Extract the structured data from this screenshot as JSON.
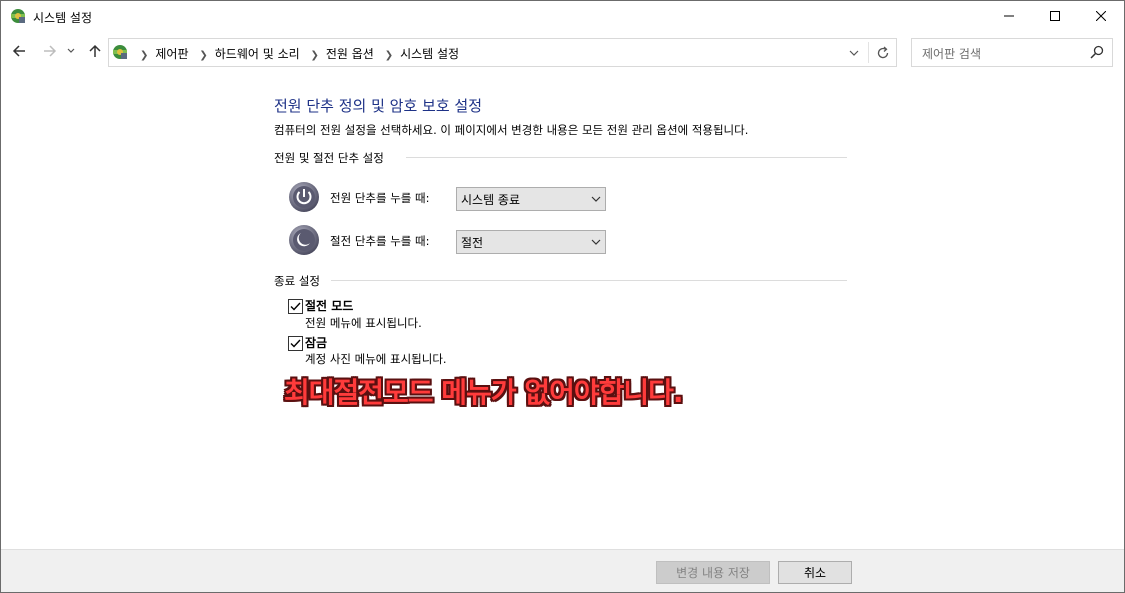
{
  "window": {
    "title": "시스템 설정",
    "icon": "control-panel-power-icon"
  },
  "nav": {
    "breadcrumbs": [
      "제어판",
      "하드웨어 및 소리",
      "전원 옵션",
      "시스템 설정"
    ],
    "search_placeholder": "제어판 검색"
  },
  "main": {
    "heading": "전원 단추 정의 및 암호 보호 설정",
    "description": "컴퓨터의 전원 설정을 선택하세요. 이 페이지에서 변경한 내용은 모든 전원 관리 옵션에 적용됩니다.",
    "power_section": {
      "title": "전원 및 절전 단추 설정",
      "power_button": {
        "label": "전원 단추를 누를 때:",
        "value": "시스템 종료"
      },
      "sleep_button": {
        "label": "절전 단추를 누를 때:",
        "value": "절전"
      }
    },
    "shutdown_section": {
      "title": "종료 설정",
      "items": [
        {
          "label": "절전 모드",
          "description": "전원 메뉴에 표시됩니다.",
          "checked": true
        },
        {
          "label": "잠금",
          "description": "계정 사진 메뉴에 표시됩니다.",
          "checked": true
        }
      ]
    },
    "annotation": "최대절전모드 메뉴가 없어야합니다."
  },
  "footer": {
    "save_label": "변경 내용 저장",
    "save_enabled": false,
    "cancel_label": "취소"
  },
  "colors": {
    "heading": "#1e3287",
    "annotation": "#ff3b3b"
  }
}
